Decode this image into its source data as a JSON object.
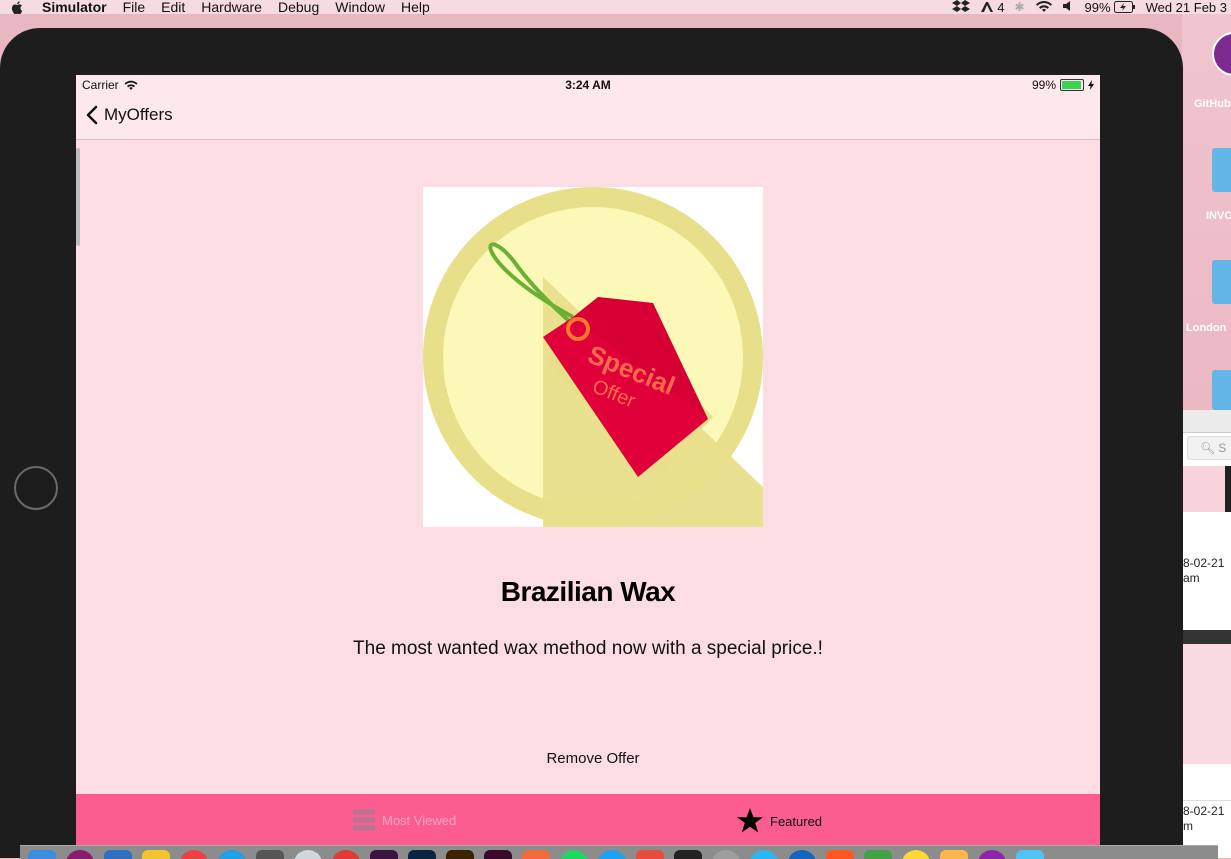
{
  "menubar": {
    "app_name": "Simulator",
    "items": [
      "File",
      "Edit",
      "Hardware",
      "Debug",
      "Window",
      "Help"
    ],
    "status": {
      "adobe_count": "4",
      "battery": "99%",
      "datetime": "Wed 21 Feb 3"
    }
  },
  "desktop": {
    "items": [
      "GitHub",
      "INVO",
      "London"
    ],
    "finder_search_placeholder": "S",
    "finder_rows": [
      "8-02-21",
      "am",
      "8-02-21",
      "m"
    ]
  },
  "status_bar": {
    "carrier": "Carrier",
    "time": "3:24 AM",
    "battery": "99%"
  },
  "nav": {
    "back_label": "MyOffers"
  },
  "offer": {
    "title": "Brazilian Wax",
    "description": "The most wanted wax method now with a special price.!",
    "badge_line1": "Special",
    "badge_line2": "Offer",
    "remove_label": "Remove Offer"
  },
  "tabs": [
    {
      "label": "Most Viewed",
      "icon": "list-icon",
      "selected": false
    },
    {
      "label": "Featured",
      "icon": "star-icon",
      "selected": true
    }
  ],
  "colors": {
    "tabbar": "#fb5d91",
    "background": "#fddde4",
    "navbar": "#fde8ee",
    "tag": "#e0003a"
  }
}
